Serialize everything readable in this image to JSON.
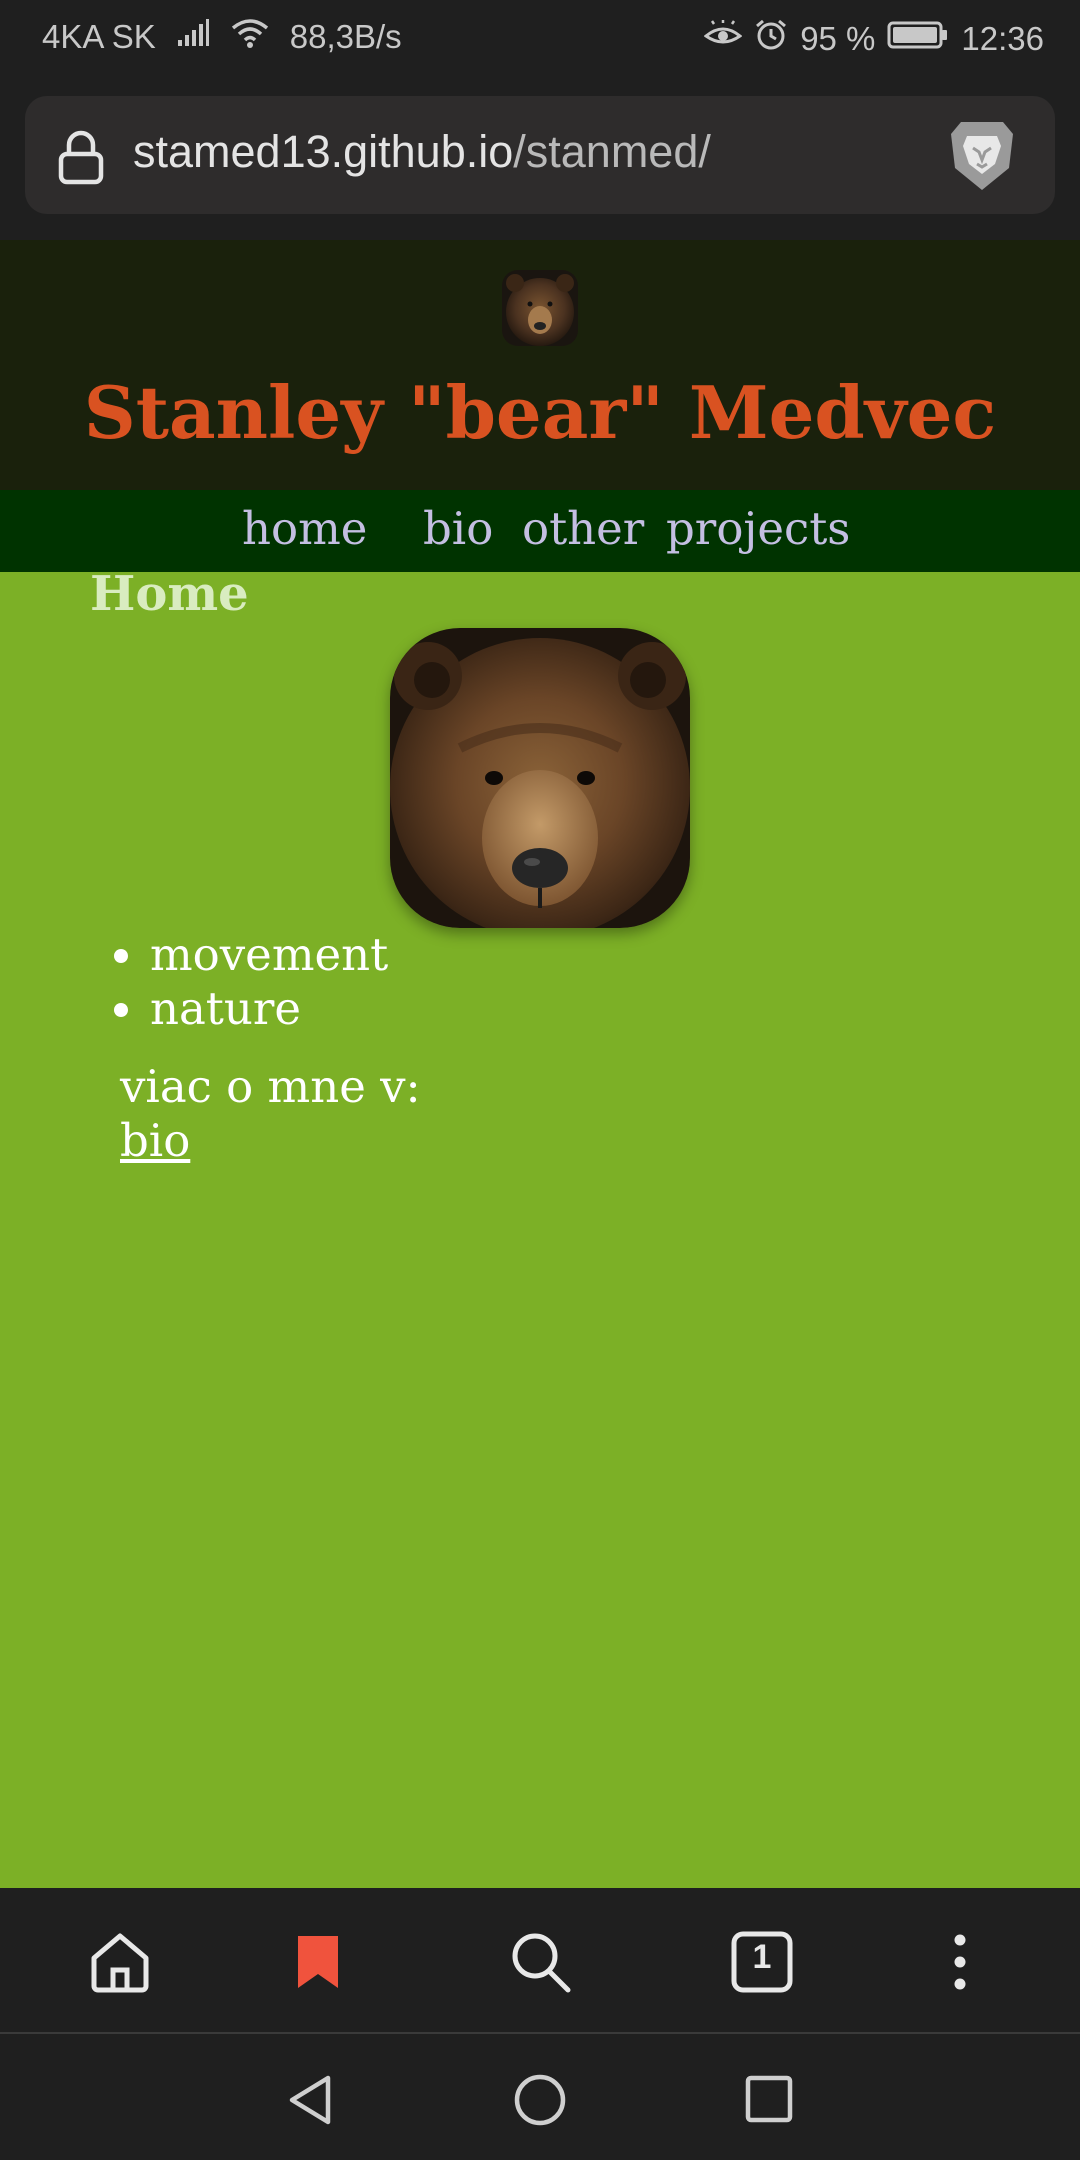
{
  "status_bar": {
    "carrier": "4KA SK",
    "speed": "88,3B/s",
    "battery": "95 %",
    "time": "12:36"
  },
  "browser": {
    "url_host": "stamed13.github.io",
    "url_path": "/stanmed/"
  },
  "site": {
    "title": "Stanley \"bear\" Medvec",
    "nav": [
      "home",
      "bio",
      "other",
      "projects"
    ]
  },
  "main": {
    "heading": "Home",
    "interests": [
      "movement",
      "nature"
    ],
    "more_text": "viac o mne v:",
    "bio_link": "bio"
  },
  "toolbar": {
    "tab_count": "1"
  },
  "colors": {
    "page_bg": "#7cb026",
    "header_bg": "#1a210c",
    "title": "#d95221",
    "nav_bg": "#003300",
    "nav_link": "#c4bfe2",
    "heading": "#d9ecc0",
    "bookmark": "#f0533d"
  }
}
